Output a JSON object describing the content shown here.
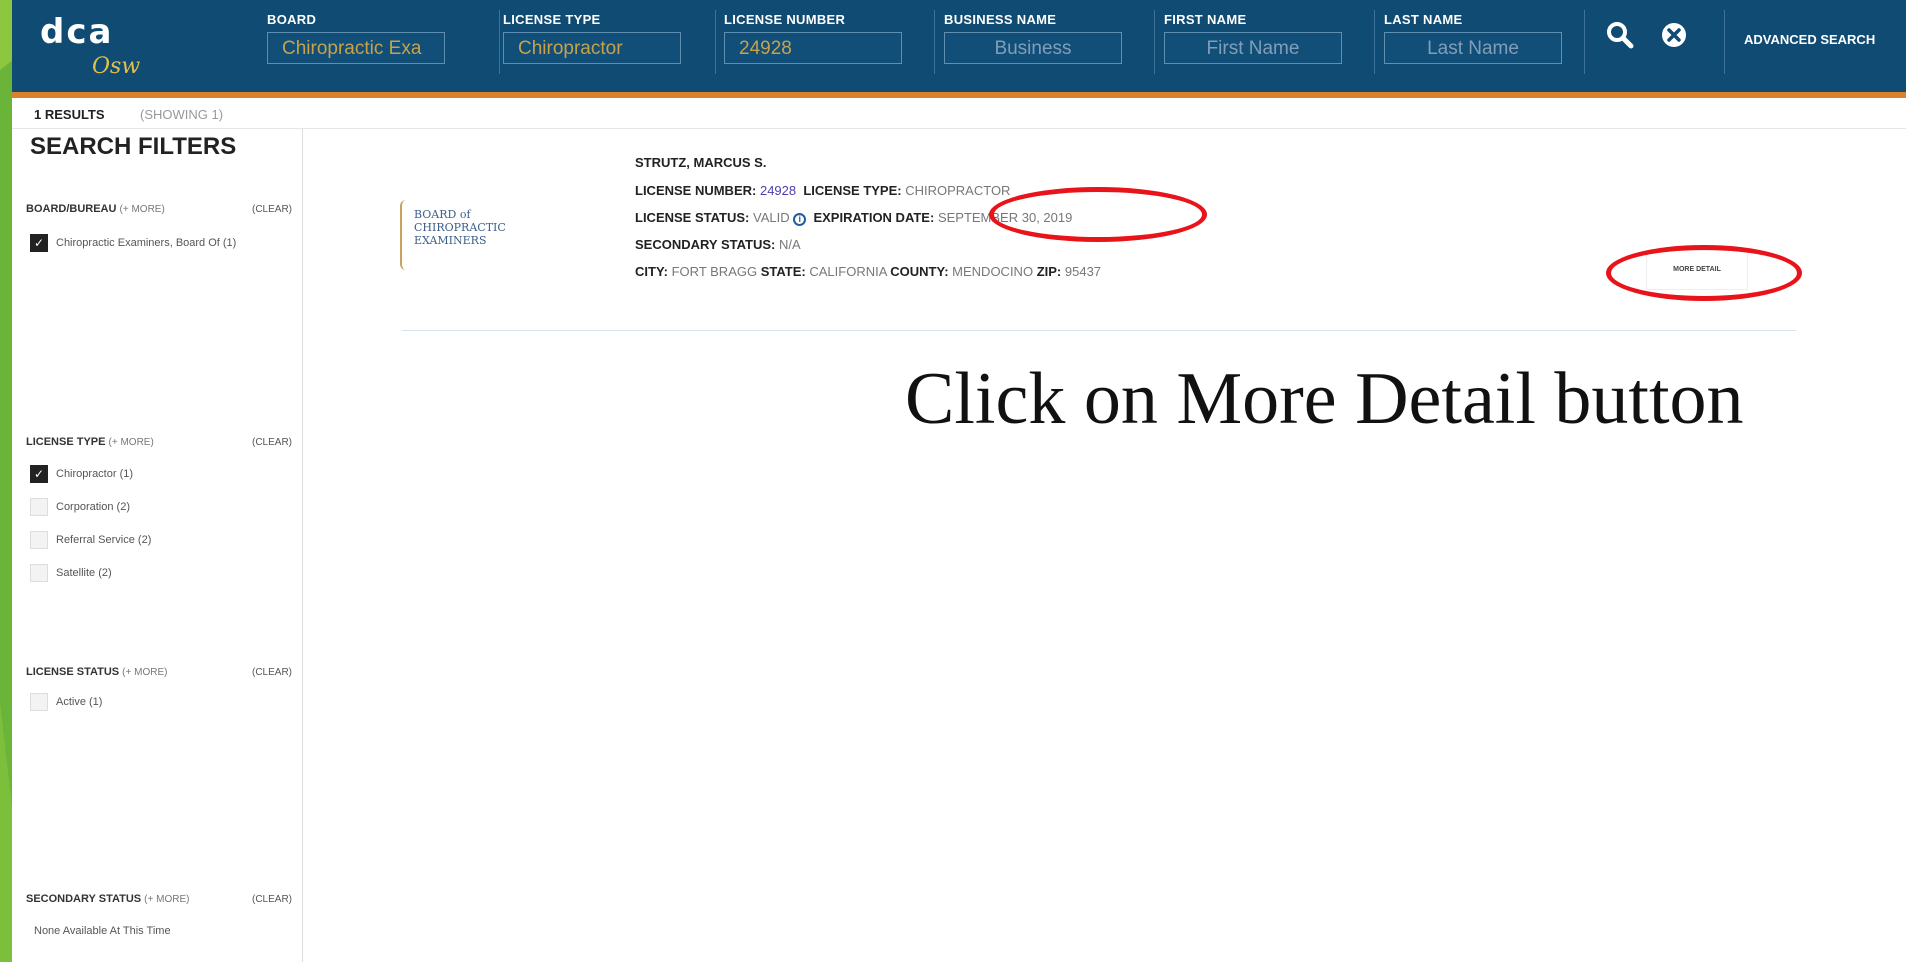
{
  "header": {
    "logo_text": "dca",
    "logo_signature": "Osw",
    "fields": [
      {
        "label": "BOARD",
        "value": "Chiropractic Exa",
        "placeholder": ""
      },
      {
        "label": "LICENSE TYPE",
        "value": "Chiropractor",
        "placeholder": ""
      },
      {
        "label": "LICENSE NUMBER",
        "value": "24928",
        "placeholder": ""
      },
      {
        "label": "BUSINESS NAME",
        "value": "",
        "placeholder": "Business"
      },
      {
        "label": "FIRST NAME",
        "value": "",
        "placeholder": "First Name"
      },
      {
        "label": "LAST NAME",
        "value": "",
        "placeholder": "Last Name"
      }
    ],
    "search_icon": "search-icon",
    "clear_icon": "close-circle-icon",
    "advanced_search": "ADVANCED SEARCH"
  },
  "results": {
    "count": "1 RESULTS",
    "showing": "(SHOWING 1)"
  },
  "sidebar": {
    "title": "SEARCH FILTERS",
    "more_label": "(+ MORE)",
    "clear_label": "(CLEAR)",
    "groups": [
      {
        "title": "BOARD/BUREAU",
        "options": [
          {
            "label": "Chiropractic Examiners, Board Of (1)",
            "checked": true
          }
        ]
      },
      {
        "title": "LICENSE TYPE",
        "options": [
          {
            "label": "Chiropractor (1)",
            "checked": true
          },
          {
            "label": "Corporation (2)",
            "checked": false
          },
          {
            "label": "Referral Service (2)",
            "checked": false
          },
          {
            "label": "Satellite (2)",
            "checked": false
          }
        ]
      },
      {
        "title": "LICENSE STATUS",
        "options": [
          {
            "label": "Active (1)",
            "checked": false
          }
        ]
      },
      {
        "title": "SECONDARY STATUS",
        "options": [
          {
            "label": "None Available At This Time",
            "checked": null
          }
        ]
      }
    ]
  },
  "result": {
    "board_logo_lines": [
      "BOARD of",
      "CHIROPRACTIC",
      "EXAMINERS"
    ],
    "name": "STRUTZ, MARCUS S.",
    "license_number_label": "LICENSE NUMBER:",
    "license_number": "24928",
    "license_type_label": "LICENSE TYPE:",
    "license_type": "CHIROPRACTOR",
    "license_status_label": "LICENSE STATUS:",
    "license_status": "VALID",
    "expiration_label": "EXPIRATION DATE:",
    "expiration_date": "SEPTEMBER 30, 2019",
    "secondary_status_label": "SECONDARY STATUS:",
    "secondary_status": "N/A",
    "city_label": "CITY:",
    "city": "FORT BRAGG",
    "state_label": "STATE:",
    "state": "CALIFORNIA",
    "county_label": "COUNTY:",
    "county": "MENDOCINO",
    "zip_label": "ZIP:",
    "zip": "95437",
    "more_detail": "MORE DETAIL"
  },
  "annotation": {
    "caption": "Click on More Detail button",
    "highlight_color": "#e8141a"
  }
}
